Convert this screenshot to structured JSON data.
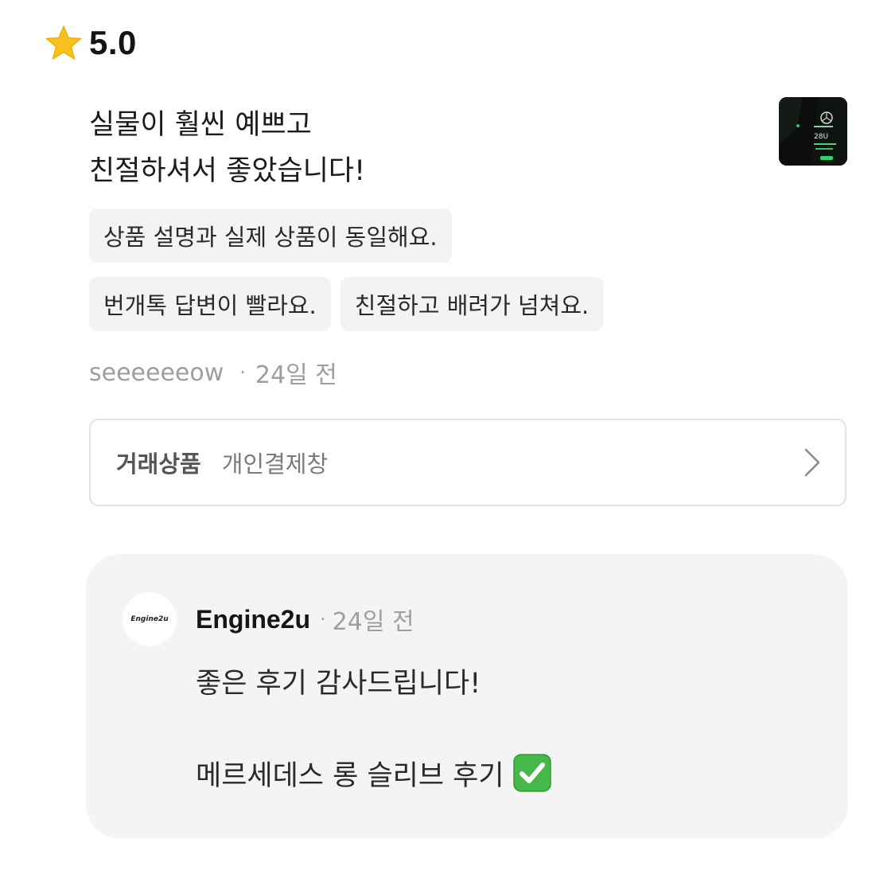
{
  "rating": {
    "icon": "star-icon",
    "value": "5.0",
    "star_color": "#F5C518"
  },
  "review": {
    "lines": [
      "실물이 훨씬 예쁘고",
      "친절하셔서 좋았습니다!"
    ],
    "tags_row1": [
      "상품 설명과 실제 상품이 동일해요."
    ],
    "tags_row2": [
      "번개톡 답변이 빨라요.",
      "친절하고 배려가 넘쳐요."
    ],
    "author": "seeeeeeow",
    "separator": "·",
    "time": "24일 전"
  },
  "deal": {
    "label": "거래상품",
    "value": "개인결제창",
    "icon": "chevron-right-icon"
  },
  "reply": {
    "avatar_text": "Engine2u",
    "name": "Engine2u",
    "separator": "·",
    "time": "24일 전",
    "line1": "좋은 후기 감사드립니다!",
    "line2": "메르세데스 롱 슬리브 후기",
    "emoji_icon": "check-mark-button-icon",
    "emoji_color": "#3CB043"
  }
}
